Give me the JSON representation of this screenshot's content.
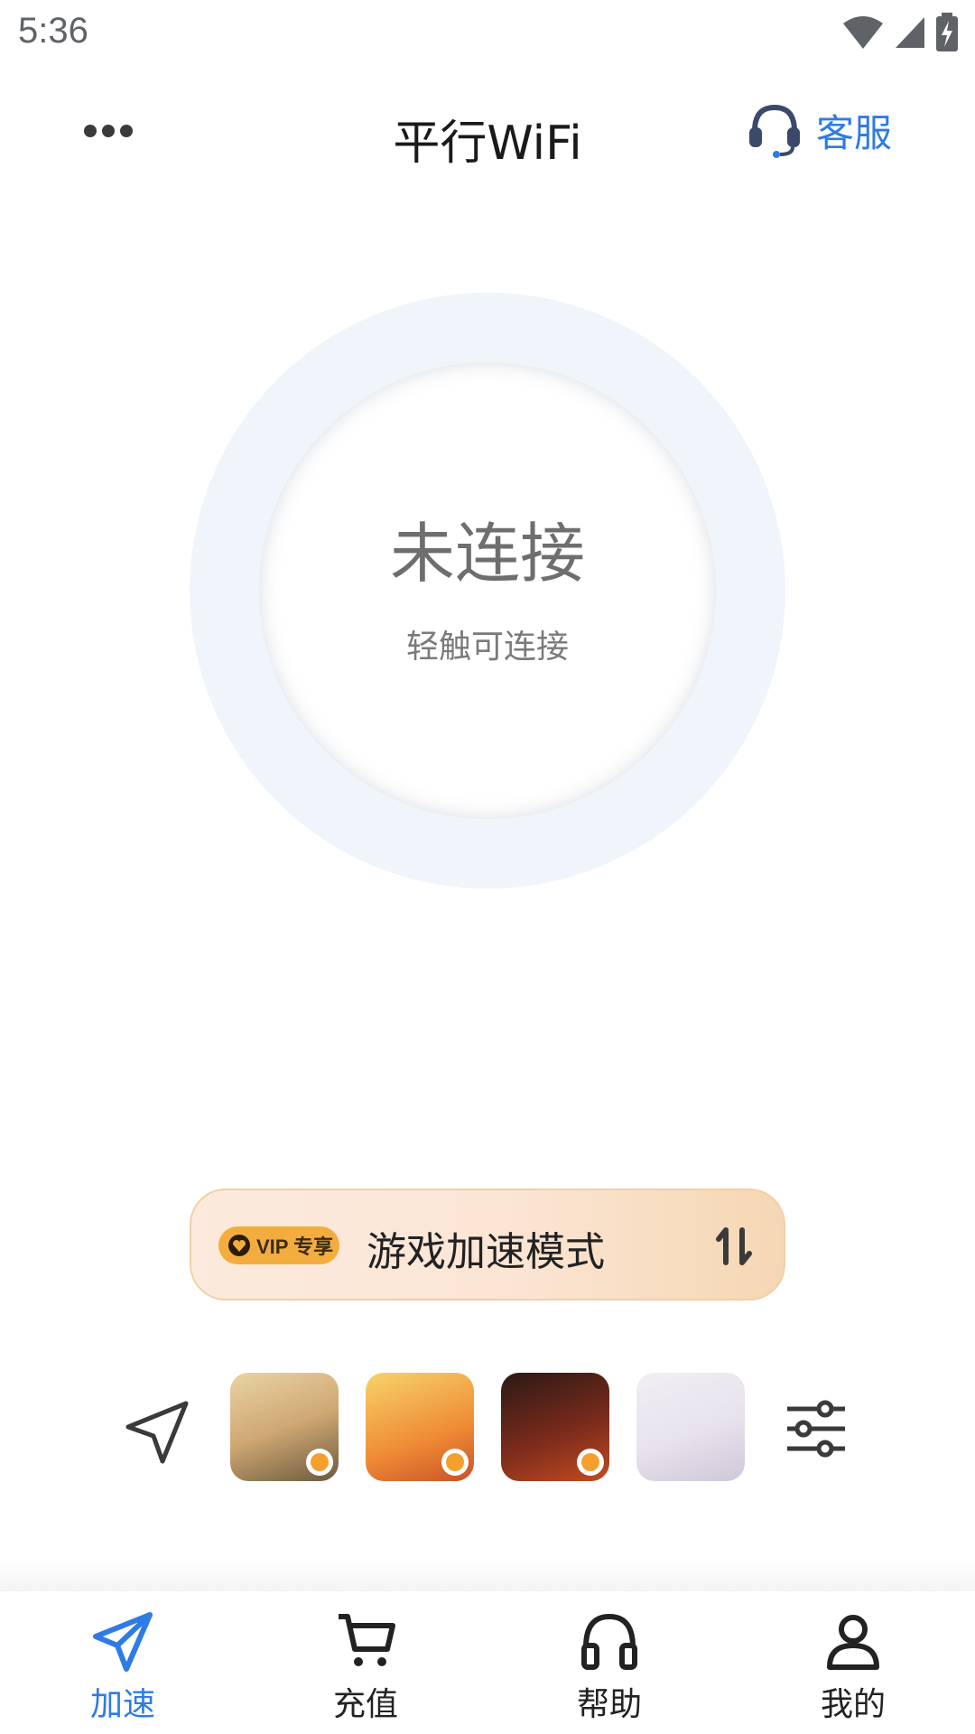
{
  "status_bar": {
    "time": "5:36",
    "icons": [
      "wifi-icon",
      "signal-icon",
      "battery-charging-icon"
    ]
  },
  "header": {
    "title": "平行WiFi",
    "more_icon": "more-dots-icon",
    "support_label": "客服",
    "support_icon": "headset-icon"
  },
  "connection": {
    "status": "未连接",
    "hint": "轻触可连接"
  },
  "mode": {
    "vip_badge": "VIP 专享",
    "label": "游戏加速模式",
    "switch_icon": "swap-vertical-icon"
  },
  "games": {
    "items": [
      "game-1",
      "game-2",
      "game-3",
      "game-4"
    ],
    "nav_icon": "navigation-arrow-icon",
    "settings_icon": "sliders-icon"
  },
  "tabs": [
    {
      "label": "加速",
      "icon": "paper-plane-icon",
      "active": true
    },
    {
      "label": "充值",
      "icon": "cart-icon",
      "active": false
    },
    {
      "label": "帮助",
      "icon": "headphones-icon",
      "active": false
    },
    {
      "label": "我的",
      "icon": "person-icon",
      "active": false
    }
  ],
  "colors": {
    "accent": "#2f7be6",
    "ring": "#f0f5fc",
    "vip_badge": "#f3ad3f",
    "text_dark": "#222222",
    "text_gray": "#6e6e6e"
  }
}
